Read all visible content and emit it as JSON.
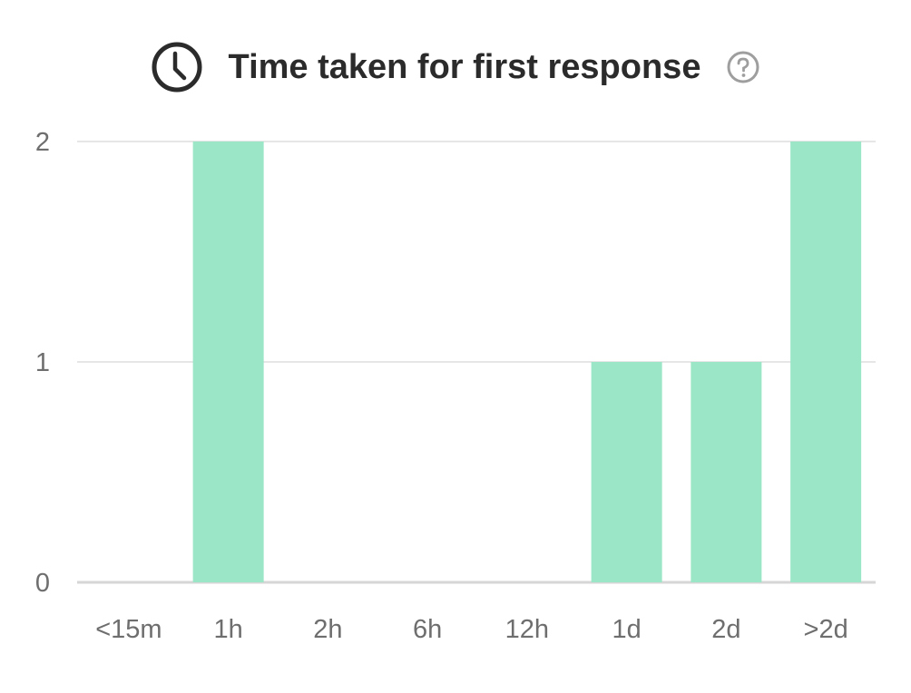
{
  "header": {
    "title": "Time taken for first response",
    "icon": "clock-icon",
    "help_icon": "question-circle-icon"
  },
  "colors": {
    "bar": "#9ae6c7",
    "grid": "#e6e6e6",
    "axis": "#d6d6d6",
    "text": "#2b2b2b",
    "tick_text": "#6e6e6e",
    "help_icon": "#9e9e9e"
  },
  "chart_data": {
    "type": "bar",
    "title": "Time taken for first response",
    "xlabel": "",
    "ylabel": "",
    "categories": [
      "<15m",
      "1h",
      "2h",
      "6h",
      "12h",
      "1d",
      "2d",
      ">2d"
    ],
    "values": [
      0,
      2,
      0,
      0,
      0,
      1,
      1,
      2
    ],
    "ylim": [
      0,
      2
    ],
    "yticks": [
      0,
      1,
      2
    ],
    "grid": true,
    "legend": "none"
  }
}
